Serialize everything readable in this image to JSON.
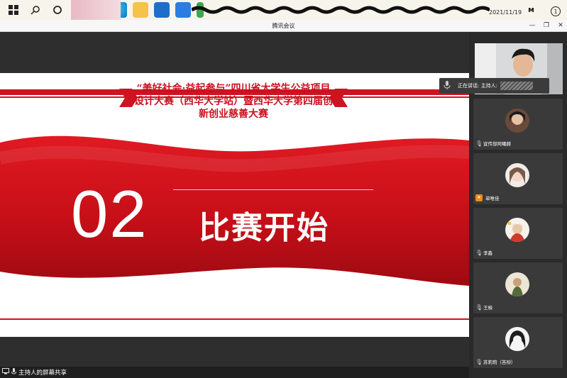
{
  "taskbar": {
    "date": "2021/11/19",
    "ime": "ᴍ",
    "notification_badge": "1"
  },
  "window": {
    "title": "腾讯会议",
    "minimize": "—",
    "restore": "❐",
    "close": "✕"
  },
  "slide": {
    "title": "“美好社会·益起参与”四川省大学生公益项目设计大赛（西华大学站）暨西华大学第四届创新创业慈善大赛",
    "number": "02",
    "heading": "比赛开始"
  },
  "speaking": {
    "label": "正在讲话: 主持人:"
  },
  "participants": [
    {
      "name": "宣传部阿曦赫"
    },
    {
      "name": "单唯佳"
    },
    {
      "name": "李鑫"
    },
    {
      "name": "王楨"
    },
    {
      "name": "苏莉莉（答辩）"
    }
  ],
  "bottom_bar": {
    "label": "主持人的屏幕共享"
  },
  "colors": {
    "accent_red": "#c8101e",
    "panel_bg": "#2a2a2a",
    "tile_bg": "#3a3a3a"
  }
}
